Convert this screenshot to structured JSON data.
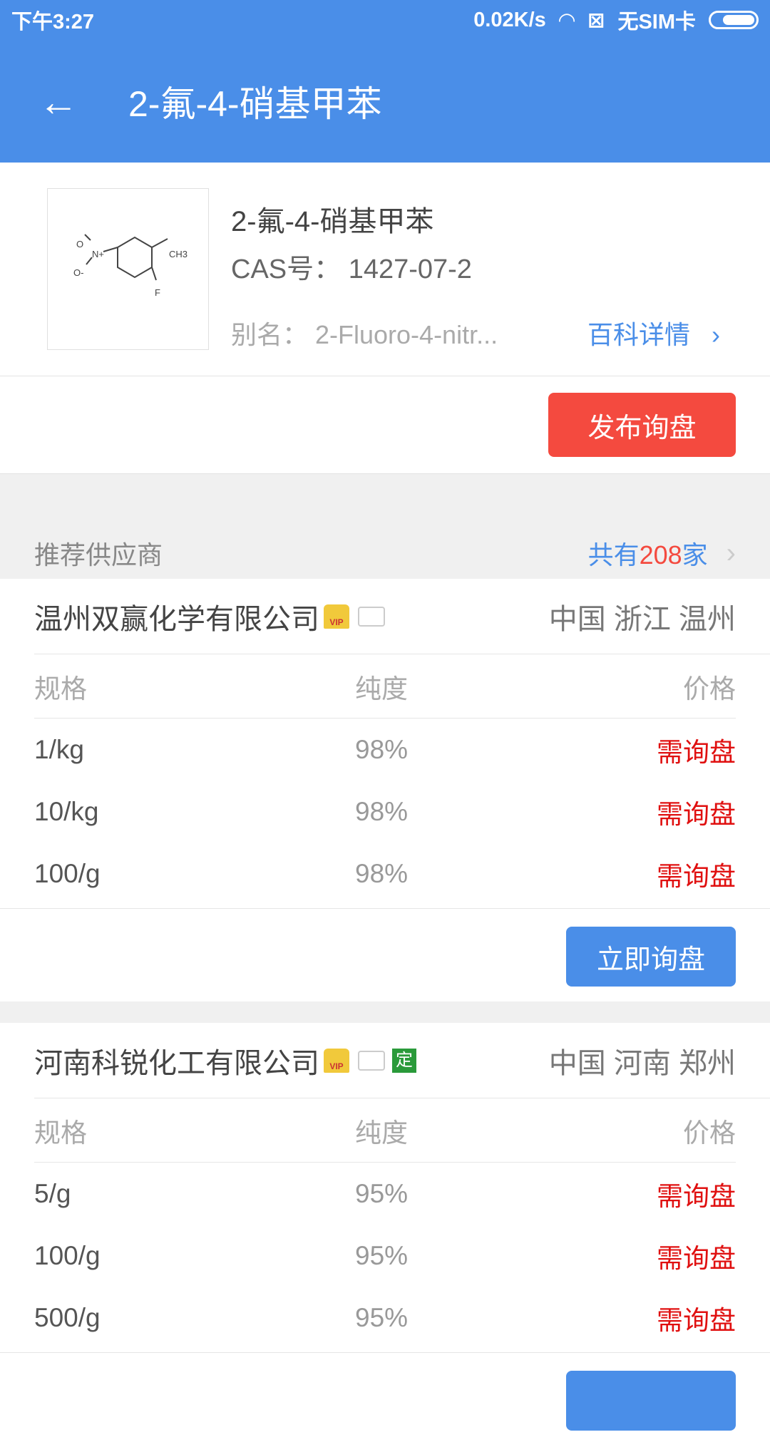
{
  "status": {
    "time": "下午3:27",
    "speed": "0.02K/s",
    "sim": "无SIM卡"
  },
  "header": {
    "title": "2-氟-4-硝基甲苯"
  },
  "product": {
    "name": "2-氟-4-硝基甲苯",
    "cas": "CAS号： 1427-07-2",
    "alias": "别名： 2-Fluoro-4-nitr...",
    "baike": "百科详情",
    "publish": "发布询盘",
    "structure_labels": {
      "ch3": "CH3",
      "f": "F",
      "n": "N+",
      "o1": "O",
      "o2": "O-"
    }
  },
  "recommend": {
    "title": "推荐供应商",
    "prefix": "共有",
    "count": "208",
    "suffix": "家"
  },
  "suppliers": [
    {
      "name": "温州双赢化学有限公司",
      "location": "中国 浙江 温州",
      "badges": [
        "vip",
        "id-card"
      ],
      "vip_text": "VIP",
      "headers": [
        "规格",
        "纯度",
        "价格"
      ],
      "rows": [
        [
          "1/kg",
          "98%",
          "需询盘"
        ],
        [
          "10/kg",
          "98%",
          "需询盘"
        ],
        [
          "100/g",
          "98%",
          "需询盘"
        ]
      ],
      "button": "立即询盘"
    },
    {
      "name": "河南科锐化工有限公司",
      "location": "中国 河南 郑州",
      "badges": [
        "vip",
        "id-card",
        "ding"
      ],
      "vip_text": "VIP",
      "ding": "定",
      "headers": [
        "规格",
        "纯度",
        "价格"
      ],
      "rows": [
        [
          "5/g",
          "95%",
          "需询盘"
        ],
        [
          "100/g",
          "95%",
          "需询盘"
        ],
        [
          "500/g",
          "95%",
          "需询盘"
        ]
      ]
    }
  ],
  "colors": {
    "primary": "#4a8ee8",
    "danger": "#f44a3f",
    "price": "#e01010"
  }
}
